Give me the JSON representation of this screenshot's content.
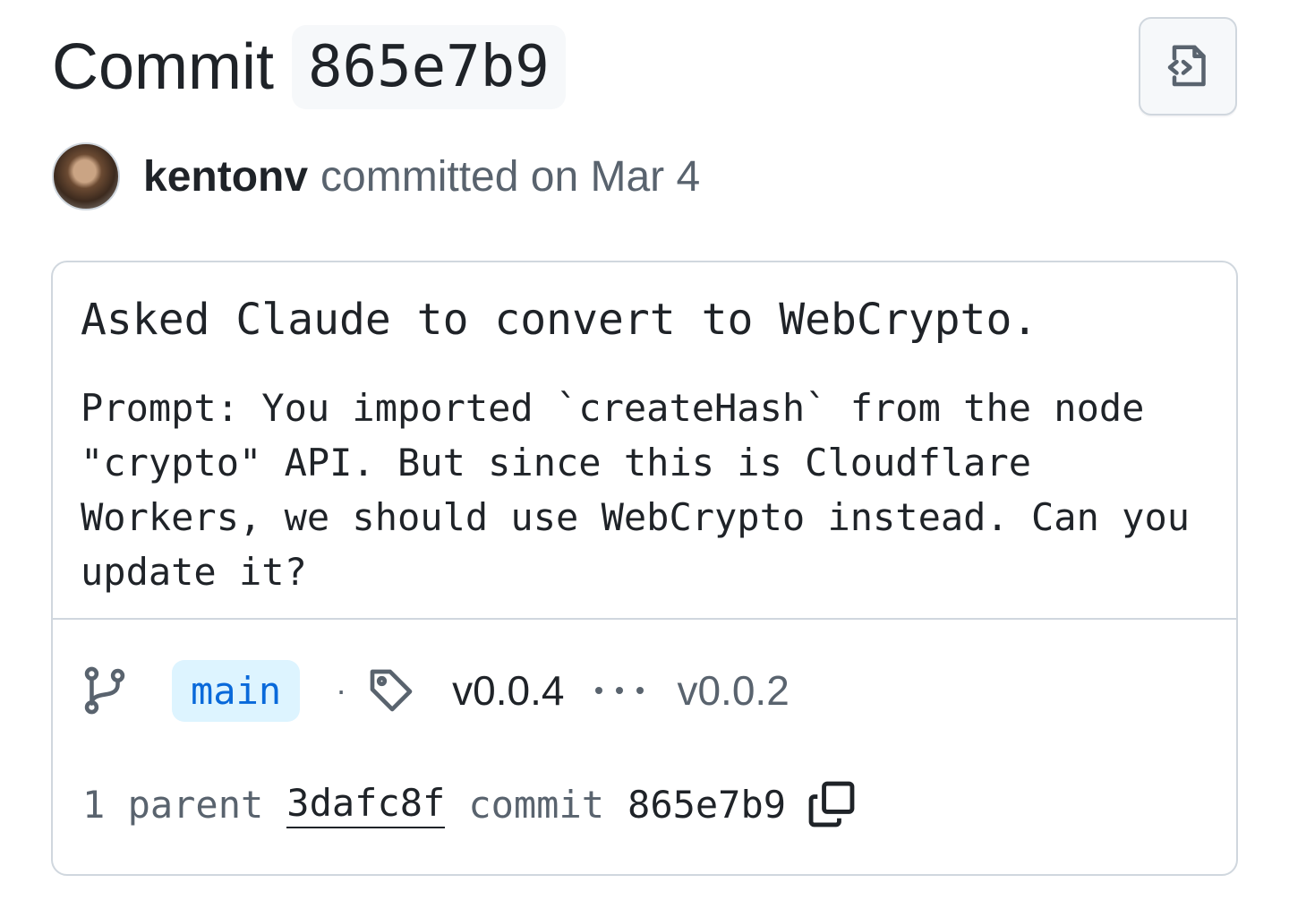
{
  "header": {
    "title_word": "Commit",
    "sha": "865e7b9",
    "browse_icon": "file-code-icon"
  },
  "author": {
    "name": "kentonv",
    "meta": "committed on Mar 4"
  },
  "message": {
    "title": "Asked Claude to convert to WebCrypto.",
    "body": "Prompt: You imported `createHash` from the node \"crypto\" API. But since this is Cloudflare Workers, we should use WebCrypto instead. Can you update it?"
  },
  "refs": {
    "branch_icon": "git-branch-icon",
    "branch": "main",
    "separator": "·",
    "tag_icon": "tag-icon",
    "tag_current": "v0.0.4",
    "ellipsis_icon": "kebab-horizontal-icon",
    "tag_other": "v0.0.2"
  },
  "shas": {
    "parent_count": "1 parent",
    "parent_sha": "3dafc8f",
    "commit_label": "commit",
    "commit_sha": "865e7b9",
    "copy_icon": "copy-icon"
  },
  "colors": {
    "text": "#1f2328",
    "muted": "#59636e",
    "border": "#d0d7de",
    "accent": "#0969da",
    "pill_bg": "#ddf4ff"
  }
}
